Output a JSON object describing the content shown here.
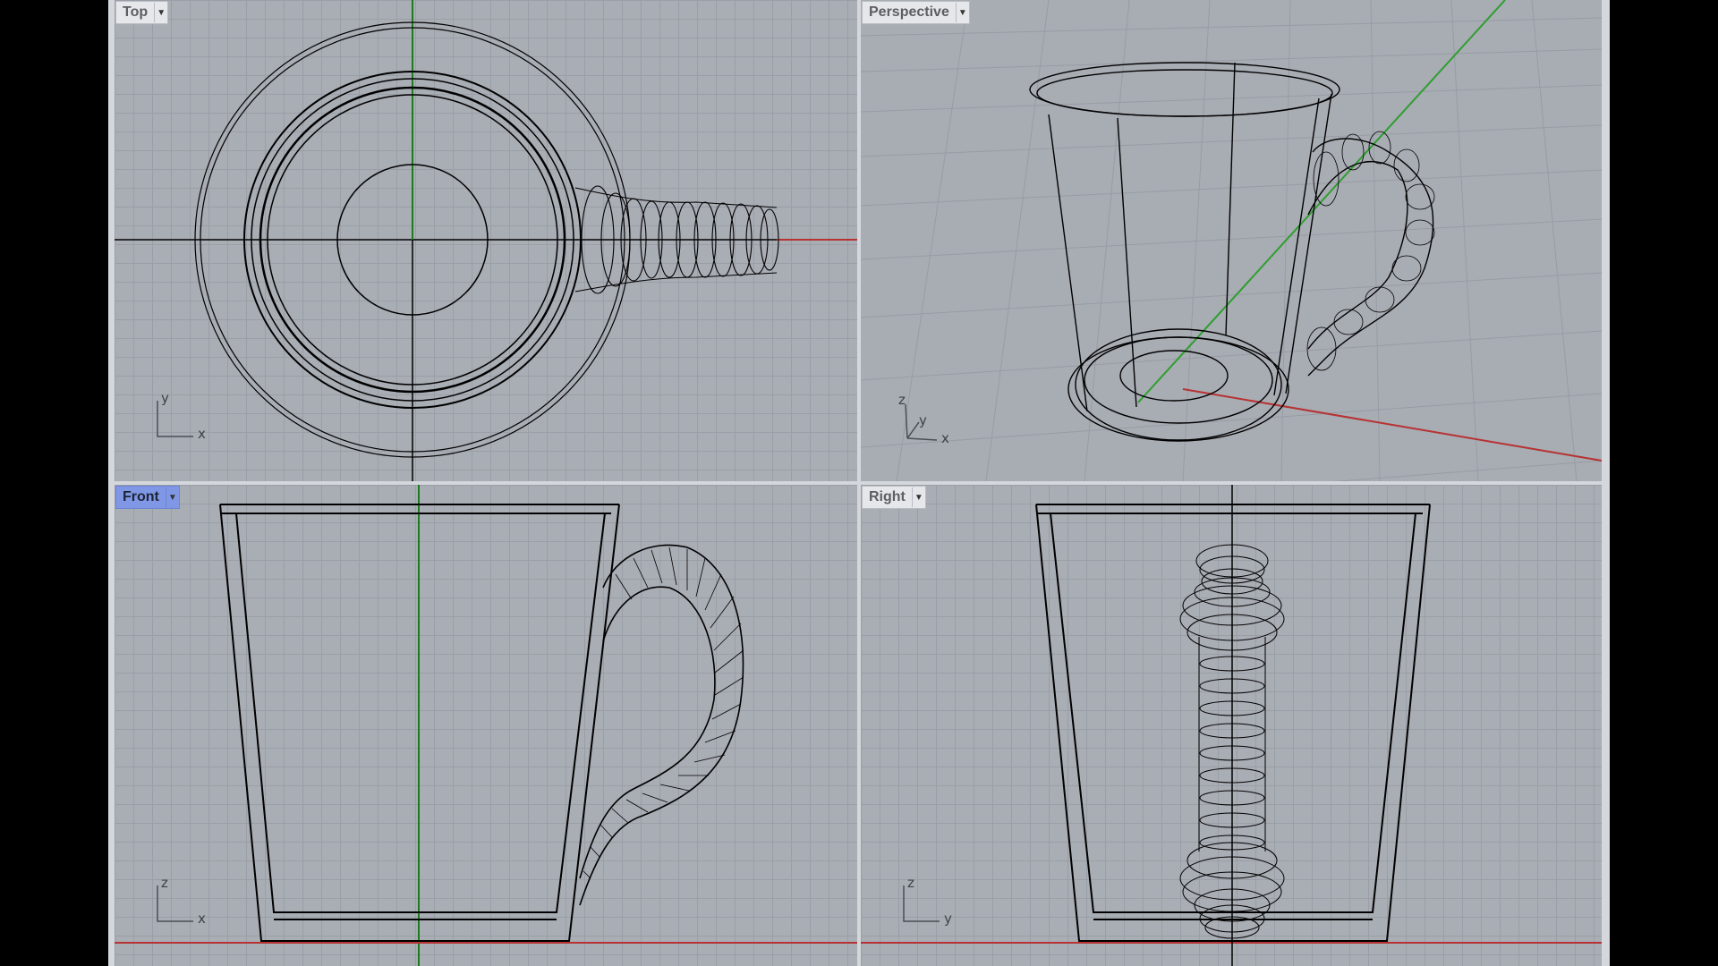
{
  "viewports": {
    "top": {
      "label": "Top",
      "axis_h": "x",
      "axis_v": "y"
    },
    "perspective": {
      "label": "Perspective",
      "axis_x": "x",
      "axis_y": "y",
      "axis_z": "z"
    },
    "front": {
      "label": "Front",
      "axis_h": "x",
      "axis_v": "z",
      "active": true
    },
    "right": {
      "label": "Right",
      "axis_h": "y",
      "axis_v": "z"
    }
  },
  "colors": {
    "viewport_bg": "#a9adb4",
    "grid_line": "#9a9ea6",
    "x_axis": "#c0392b",
    "y_axis": "#2e7d32",
    "wire": "#000000",
    "active_tab": "#7f97e4"
  },
  "icons": {
    "viewport_menu": "dropdown-arrow-icon",
    "axis_gizmo": "axis-gizmo-icon"
  }
}
